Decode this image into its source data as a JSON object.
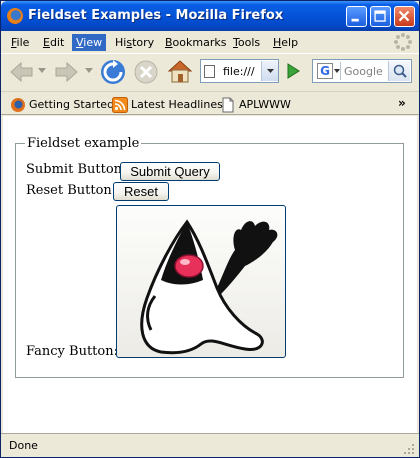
{
  "window": {
    "title": "Fieldset Examples - Mozilla Firefox"
  },
  "menu": {
    "items": [
      {
        "prefix": "",
        "key": "F",
        "rest": "ile",
        "active": false
      },
      {
        "prefix": "",
        "key": "E",
        "rest": "dit",
        "active": false
      },
      {
        "prefix": "",
        "key": "V",
        "rest": "iew",
        "active": true
      },
      {
        "prefix": "Hi",
        "key": "s",
        "rest": "tory",
        "active": false
      },
      {
        "prefix": "",
        "key": "B",
        "rest": "ookmarks",
        "active": false
      },
      {
        "prefix": "",
        "key": "T",
        "rest": "ools",
        "active": false
      },
      {
        "prefix": "",
        "key": "H",
        "rest": "elp",
        "active": false
      }
    ]
  },
  "toolbar": {
    "address_value": "file:///",
    "search_placeholder": "Google"
  },
  "bookmarks": {
    "items": [
      {
        "label": "Getting Started",
        "icon": "firefox-icon"
      },
      {
        "label": "Latest Headlines",
        "icon": "rss-feed-icon"
      },
      {
        "label": "APLWWW",
        "icon": "page-icon"
      }
    ],
    "overflow": "»"
  },
  "page": {
    "legend": "Fieldset example",
    "submit_label": "Submit Button:",
    "submit_button": "Submit Query",
    "reset_label": "Reset Button:",
    "reset_button": "Reset",
    "fancy_label": "Fancy Button:"
  },
  "status": {
    "text": "Done"
  },
  "colors": {
    "titlebar": "#0453d8",
    "menu_highlight": "#316ac5",
    "button_border": "#003c74",
    "mascot_nose": "#e8315a"
  }
}
